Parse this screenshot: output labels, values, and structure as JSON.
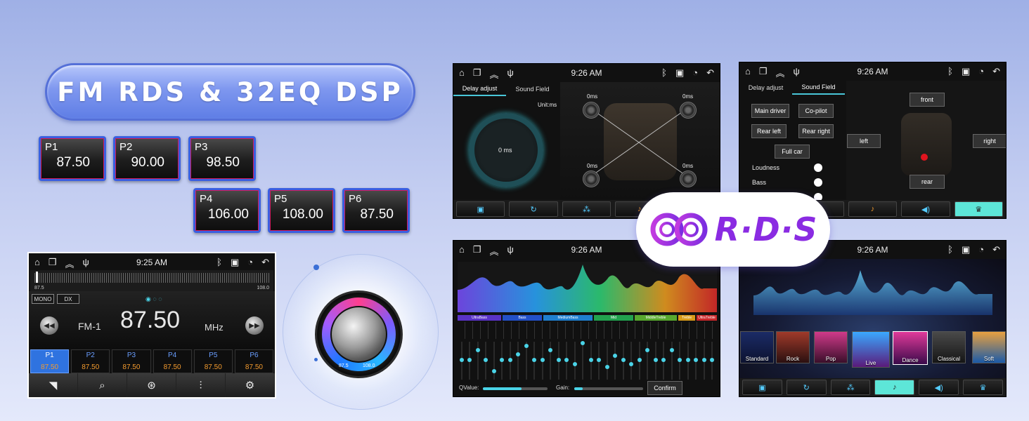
{
  "title": "FM RDS & 32EQ DSP",
  "presets": [
    {
      "name": "P1",
      "freq": "87.50"
    },
    {
      "name": "P2",
      "freq": "90.00"
    },
    {
      "name": "P3",
      "freq": "98.50"
    },
    {
      "name": "P4",
      "freq": "106.00"
    },
    {
      "name": "P5",
      "freq": "108.00"
    },
    {
      "name": "P6",
      "freq": "87.50"
    }
  ],
  "radio": {
    "time": "9:25 AM",
    "scale_min": "87.5",
    "scale_max": "108.0",
    "mono": "MONO",
    "dx": "DX",
    "band": "FM-1",
    "frequency": "87.50",
    "unit": "MHz",
    "presets": [
      {
        "name": "P1",
        "freq": "87.50"
      },
      {
        "name": "P2",
        "freq": "87.50"
      },
      {
        "name": "P3",
        "freq": "87.50"
      },
      {
        "name": "P4",
        "freq": "87.50"
      },
      {
        "name": "P5",
        "freq": "87.50"
      },
      {
        "name": "P6",
        "freq": "87.50"
      }
    ]
  },
  "knob": {
    "min": "87.5",
    "max": "108.0"
  },
  "delay": {
    "time": "9:26 AM",
    "tabs": [
      "Delay adjust",
      "Sound Field"
    ],
    "unit": "Unit:ms",
    "center": "0 ms",
    "fl": "0ms",
    "fr": "0ms",
    "rl": "0ms",
    "rr": "0ms"
  },
  "soundfield": {
    "time": "9:26 AM",
    "tabs": [
      "Delay adjust",
      "Sound Field"
    ],
    "main_driver": "Main driver",
    "copilot": "Co-pilot",
    "rear_left": "Rear left",
    "rear_right": "Rear right",
    "full_car": "Full car",
    "loudness": "Loudness",
    "bass": "Bass",
    "front": "front",
    "left": "left",
    "right": "right",
    "rear": "rear"
  },
  "rds": {
    "label": "R·D·S"
  },
  "eq": {
    "time": "9:26 AM",
    "categories": [
      "UltraBass",
      "Bass",
      "MediumBass",
      "Mid",
      "MiddleTreble",
      "Treble",
      "UltraTreble"
    ],
    "qvalue": "QValue:",
    "gain": "Gain:",
    "confirm": "Confirm",
    "qvalue_level": 0.6,
    "gain_level": 0.12
  },
  "mode": {
    "time": "9:26 AM",
    "tiles": [
      "Standard",
      "Rock",
      "Pop",
      "Live",
      "Dance",
      "Classical",
      "Soft"
    ],
    "selected": "Dance"
  },
  "colors": {
    "accent": "#4ad4e8",
    "preset_border": "#3a5fe0",
    "freq_orange": "#f29a2e",
    "rds_purple": "#8a2be2"
  }
}
